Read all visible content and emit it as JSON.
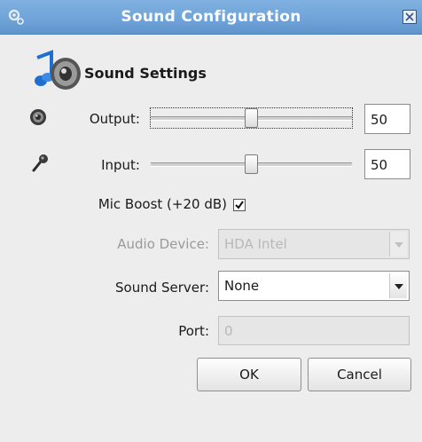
{
  "window": {
    "title": "Sound Configuration",
    "close_glyph": "×"
  },
  "header": {
    "title": "Sound Settings",
    "icon": "music-note-speaker-icon"
  },
  "output": {
    "label": "Output:",
    "icon": "speaker-icon",
    "value": "50",
    "level": 0.5
  },
  "input": {
    "label": "Input:",
    "icon": "microphone-icon",
    "value": "50",
    "level": 0.5
  },
  "mic_boost": {
    "label": "Mic Boost (+20 dB)",
    "checked": true
  },
  "audio_device": {
    "label": "Audio Device:",
    "value": "HDA Intel",
    "enabled": false
  },
  "sound_server": {
    "label": "Sound Server:",
    "value": "None",
    "enabled": true
  },
  "port": {
    "label": "Port:",
    "value": "0",
    "enabled": false
  },
  "buttons": {
    "ok": "OK",
    "cancel": "Cancel"
  },
  "colors": {
    "titlebar": "#6fa3d8",
    "background": "#ededed"
  }
}
